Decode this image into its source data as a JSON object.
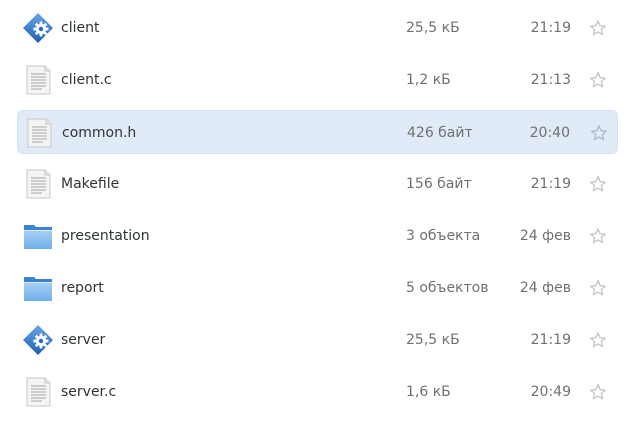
{
  "colors": {
    "selected_row_bg": "#e1ebf8",
    "text_primary": "#2e3436",
    "text_secondary": "#707070",
    "star_outline": "#c6c6c6"
  },
  "files": [
    {
      "name": "client",
      "size": "25,5 кБ",
      "modified": "21:19",
      "icon": "executable-icon",
      "selected": false,
      "starred": false
    },
    {
      "name": "client.c",
      "size": "1,2 кБ",
      "modified": "21:13",
      "icon": "text-file-icon",
      "selected": false,
      "starred": false
    },
    {
      "name": "common.h",
      "size": "426 байт",
      "modified": "20:40",
      "icon": "text-file-icon",
      "selected": true,
      "starred": false
    },
    {
      "name": "Makefile",
      "size": "156 байт",
      "modified": "21:19",
      "icon": "text-file-icon",
      "selected": false,
      "starred": false
    },
    {
      "name": "presentation",
      "size": "3 объекта",
      "modified": "24 фев",
      "icon": "folder-icon",
      "selected": false,
      "starred": false
    },
    {
      "name": "report",
      "size": "5 объектов",
      "modified": "24 фев",
      "icon": "folder-icon",
      "selected": false,
      "starred": false
    },
    {
      "name": "server",
      "size": "25,5 кБ",
      "modified": "21:19",
      "icon": "executable-icon",
      "selected": false,
      "starred": false
    },
    {
      "name": "server.c",
      "size": "1,6 кБ",
      "modified": "20:49",
      "icon": "text-file-icon",
      "selected": false,
      "starred": false
    }
  ]
}
